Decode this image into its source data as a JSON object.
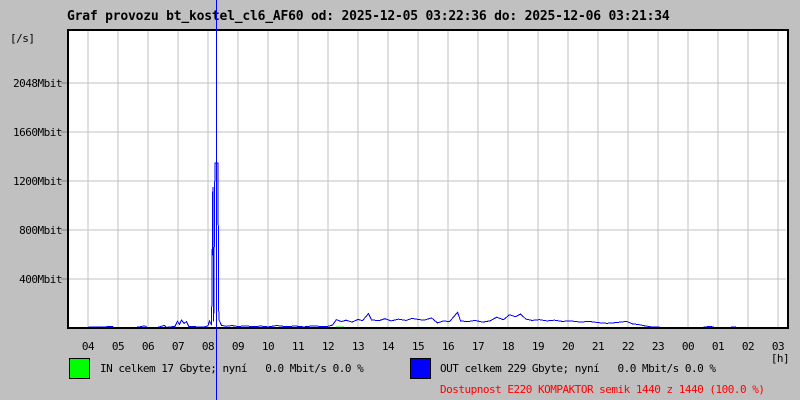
{
  "header": {
    "title": "Graf provozu bt_kostel_cl6_AF60 od: 2025-12-05 03:22:36 do: 2025-12-06 03:21:34"
  },
  "legend": {
    "in_label": "IN celkem 17 Gbyte; nyní   0.0 Mbit/s 0.0 %",
    "in_color": "#00ff00",
    "out_label": "OUT celkem 229 Gbyte; nyní   0.0 Mbit/s 0.0 %",
    "out_color": "#0000ff"
  },
  "availability": {
    "text": "Dostupnost E220 KOMPAKTOR semik 1440 z 1440 (100.0 %)",
    "color": "#ff0000"
  },
  "chart_data": {
    "type": "line",
    "title": "Graf provozu bt_kostel_cl6_AF60 od: 2025-12-05 03:22:36 do: 2025-12-06 03:21:34",
    "xlabel": "[h]",
    "ylabel": "[/s]",
    "x_ticks": [
      "04",
      "05",
      "06",
      "07",
      "08",
      "09",
      "10",
      "11",
      "12",
      "13",
      "14",
      "15",
      "16",
      "17",
      "18",
      "19",
      "20",
      "21",
      "22",
      "23",
      "00",
      "01",
      "02",
      "03"
    ],
    "y_ticks": [
      {
        "label": "400Mbit",
        "value": 400
      },
      {
        "label": "800Mbit",
        "value": 800
      },
      {
        "label": "1200Mbit",
        "value": 1200
      },
      {
        "label": "1660Mbit",
        "value": 1660
      },
      {
        "label": "2048Mbit",
        "value": 2048
      }
    ],
    "x_range_hours": [
      3.38,
      27.36
    ],
    "ylim": [
      0,
      2424
    ],
    "cursor_hour": 8.283,
    "grid": true,
    "legend_position": "bottom",
    "colors": {
      "grid": "#c0c0c0",
      "tick": "#808080",
      "frame": "#000000",
      "plot_bg": "#ffffff",
      "page_bg": "#c0c0c0"
    },
    "unit": "Mbit/s",
    "series": [
      {
        "name": "IN",
        "color": "#00ff00",
        "points": [
          [
            3.38,
            1
          ],
          [
            7.0,
            1
          ],
          [
            8.1,
            2
          ],
          [
            8.25,
            4
          ],
          [
            8.4,
            1
          ],
          [
            12.2,
            3
          ],
          [
            12.3,
            7
          ],
          [
            12.55,
            6
          ],
          [
            12.7,
            2
          ],
          [
            13.5,
            2
          ],
          [
            16.0,
            2
          ],
          [
            18.0,
            3
          ],
          [
            19.5,
            2
          ],
          [
            22.0,
            1
          ],
          [
            27.35,
            1
          ]
        ]
      },
      {
        "name": "OUT",
        "color": "#0000ff",
        "points": [
          [
            3.38,
            2
          ],
          [
            3.7,
            2
          ],
          [
            4.0,
            3
          ],
          [
            4.05,
            10
          ],
          [
            4.3,
            7
          ],
          [
            4.6,
            10
          ],
          [
            4.82,
            12
          ],
          [
            4.87,
            2
          ],
          [
            5.2,
            3
          ],
          [
            5.55,
            2
          ],
          [
            5.9,
            18
          ],
          [
            5.97,
            4
          ],
          [
            6.3,
            3
          ],
          [
            6.55,
            22
          ],
          [
            6.62,
            5
          ],
          [
            6.9,
            14
          ],
          [
            6.98,
            55
          ],
          [
            7.05,
            30
          ],
          [
            7.12,
            65
          ],
          [
            7.2,
            38
          ],
          [
            7.28,
            52
          ],
          [
            7.36,
            14
          ],
          [
            7.6,
            10
          ],
          [
            7.85,
            7
          ],
          [
            8.0,
            18
          ],
          [
            8.05,
            58
          ],
          [
            8.12,
            24
          ],
          [
            8.16,
            1150
          ],
          [
            8.19,
            55
          ],
          [
            8.23,
            1346
          ],
          [
            8.33,
            1346
          ],
          [
            8.36,
            70
          ],
          [
            8.45,
            22
          ],
          [
            8.6,
            14
          ],
          [
            8.8,
            20
          ],
          [
            9.0,
            12
          ],
          [
            9.25,
            18
          ],
          [
            9.5,
            10
          ],
          [
            9.75,
            16
          ],
          [
            10.0,
            9
          ],
          [
            10.3,
            20
          ],
          [
            10.6,
            11
          ],
          [
            10.9,
            16
          ],
          [
            11.2,
            9
          ],
          [
            11.5,
            18
          ],
          [
            11.8,
            12
          ],
          [
            12.0,
            14
          ],
          [
            12.15,
            24
          ],
          [
            12.28,
            68
          ],
          [
            12.45,
            52
          ],
          [
            12.6,
            64
          ],
          [
            12.8,
            48
          ],
          [
            13.0,
            70
          ],
          [
            13.15,
            60
          ],
          [
            13.35,
            118
          ],
          [
            13.45,
            66
          ],
          [
            13.7,
            60
          ],
          [
            13.9,
            76
          ],
          [
            14.1,
            58
          ],
          [
            14.35,
            72
          ],
          [
            14.6,
            62
          ],
          [
            14.8,
            78
          ],
          [
            15.0,
            70
          ],
          [
            15.2,
            64
          ],
          [
            15.45,
            82
          ],
          [
            15.65,
            42
          ],
          [
            15.85,
            58
          ],
          [
            16.05,
            52
          ],
          [
            16.32,
            128
          ],
          [
            16.42,
            58
          ],
          [
            16.65,
            52
          ],
          [
            16.9,
            62
          ],
          [
            17.15,
            48
          ],
          [
            17.4,
            58
          ],
          [
            17.62,
            88
          ],
          [
            17.85,
            68
          ],
          [
            18.05,
            108
          ],
          [
            18.25,
            92
          ],
          [
            18.42,
            114
          ],
          [
            18.6,
            72
          ],
          [
            18.8,
            62
          ],
          [
            19.05,
            68
          ],
          [
            19.3,
            58
          ],
          [
            19.55,
            64
          ],
          [
            19.8,
            54
          ],
          [
            20.1,
            58
          ],
          [
            20.4,
            48
          ],
          [
            20.7,
            54
          ],
          [
            21.0,
            44
          ],
          [
            21.3,
            38
          ],
          [
            21.6,
            44
          ],
          [
            21.95,
            54
          ],
          [
            22.15,
            34
          ],
          [
            22.35,
            28
          ],
          [
            22.55,
            18
          ],
          [
            22.75,
            10
          ],
          [
            23.0,
            7
          ],
          [
            23.2,
            3
          ],
          [
            23.5,
            6
          ],
          [
            23.75,
            2
          ],
          [
            24.1,
            5
          ],
          [
            24.4,
            2
          ],
          [
            24.75,
            14
          ],
          [
            24.9,
            3
          ],
          [
            25.2,
            2
          ],
          [
            25.55,
            8
          ],
          [
            25.7,
            2
          ],
          [
            26.1,
            2
          ],
          [
            26.45,
            6
          ],
          [
            26.6,
            2
          ],
          [
            27.0,
            2
          ],
          [
            27.35,
            2
          ]
        ]
      }
    ]
  }
}
